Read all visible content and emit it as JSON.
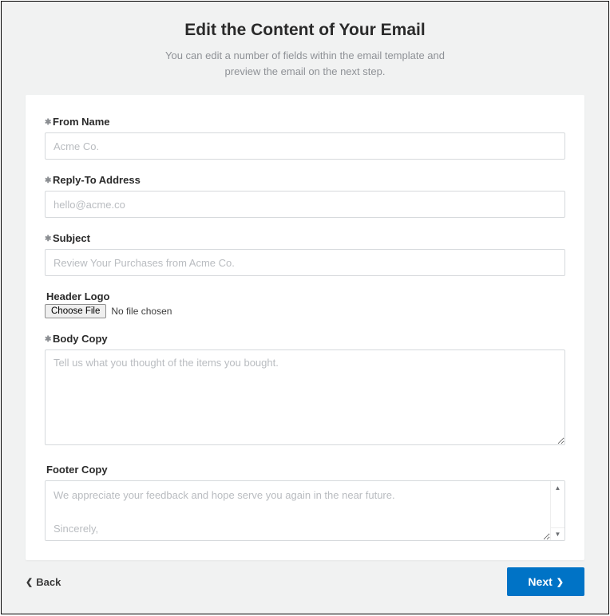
{
  "header": {
    "title": "Edit the Content of Your Email",
    "subtitle_line1": "You can edit a number of fields within the email template and",
    "subtitle_line2": "preview the email on the next step."
  },
  "form": {
    "from_name": {
      "label": "From Name",
      "placeholder": "Acme Co."
    },
    "reply_to": {
      "label": "Reply-To Address",
      "placeholder": "hello@acme.co"
    },
    "subject": {
      "label": "Subject",
      "placeholder": "Review Your Purchases from Acme Co."
    },
    "header_logo": {
      "label": "Header Logo",
      "button": "Choose File",
      "status": "No file chosen"
    },
    "body_copy": {
      "label": "Body Copy",
      "placeholder": "Tell us what you thought of the items you bought."
    },
    "footer_copy": {
      "label": "Footer Copy",
      "value": "We appreciate your feedback and hope serve you again in the near future.\n\nSincerely,"
    }
  },
  "nav": {
    "back": "Back",
    "next": "Next"
  }
}
